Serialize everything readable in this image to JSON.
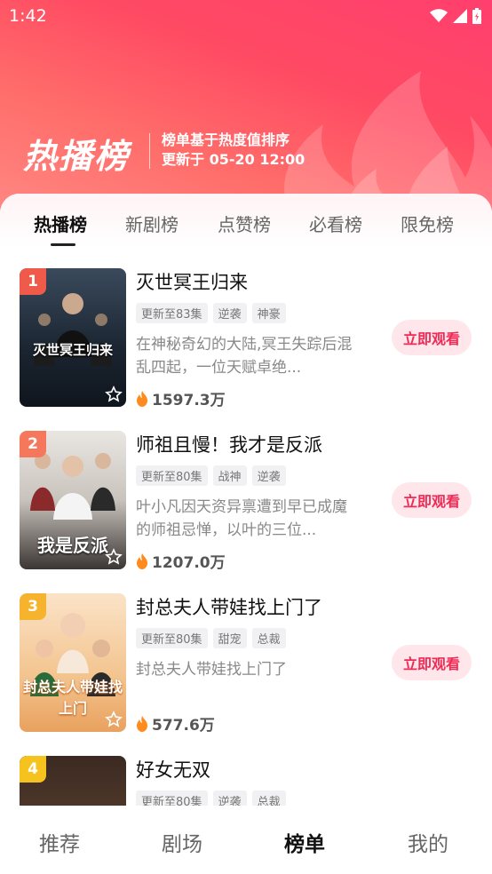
{
  "status": {
    "time": "1:42"
  },
  "header": {
    "title": "热播榜",
    "desc_line1": "榜单基于热度值排序",
    "desc_line2": "更新于 05-20 12:00"
  },
  "tabs": [
    {
      "label": "热播榜",
      "active": true
    },
    {
      "label": "新剧榜",
      "active": false
    },
    {
      "label": "点赞榜",
      "active": false
    },
    {
      "label": "必看榜",
      "active": false
    },
    {
      "label": "限免榜",
      "active": false
    }
  ],
  "items": [
    {
      "rank": "1",
      "rank_color": "#f05a4a",
      "title": "灭世冥王归来",
      "poster_text": "灭世冥王归来",
      "tags": [
        "更新至83集",
        "逆袭",
        "神豪"
      ],
      "desc": "在神秘奇幻的大陆,冥王失踪后混乱四起，一位天赋卓绝...",
      "heat": "1597.3万",
      "button": "立即观看"
    },
    {
      "rank": "2",
      "rank_color": "#f5785c",
      "title": "师祖且慢！我才是反派",
      "poster_text": "我是反派",
      "tags": [
        "更新至80集",
        "战神",
        "逆袭"
      ],
      "desc": "叶小凡因天资异禀遭到早已成魔的师祖忌惮，以叶的三位...",
      "heat": "1207.0万",
      "button": "立即观看"
    },
    {
      "rank": "3",
      "rank_color": "#f5b32e",
      "title": "封总夫人带娃找上门了",
      "poster_text": "封总夫人带娃找上门",
      "tags": [
        "更新至80集",
        "甜宠",
        "总裁"
      ],
      "desc": "封总夫人带娃找上门了",
      "heat": "577.6万",
      "button": "立即观看"
    },
    {
      "rank": "4",
      "rank_color": "#f5c21e",
      "title": "好女无双",
      "poster_text": "",
      "tags": [
        "更新至80集",
        "逆袭",
        "总裁"
      ],
      "desc": "",
      "heat": "",
      "button": ""
    }
  ],
  "bottom_nav": [
    {
      "label": "推荐",
      "active": false
    },
    {
      "label": "剧场",
      "active": false
    },
    {
      "label": "榜单",
      "active": true
    },
    {
      "label": "我的",
      "active": false
    }
  ],
  "colors": {
    "brand": "#ff4a63",
    "button_text": "#ee2a55",
    "button_bg": "#ffe6ea"
  }
}
